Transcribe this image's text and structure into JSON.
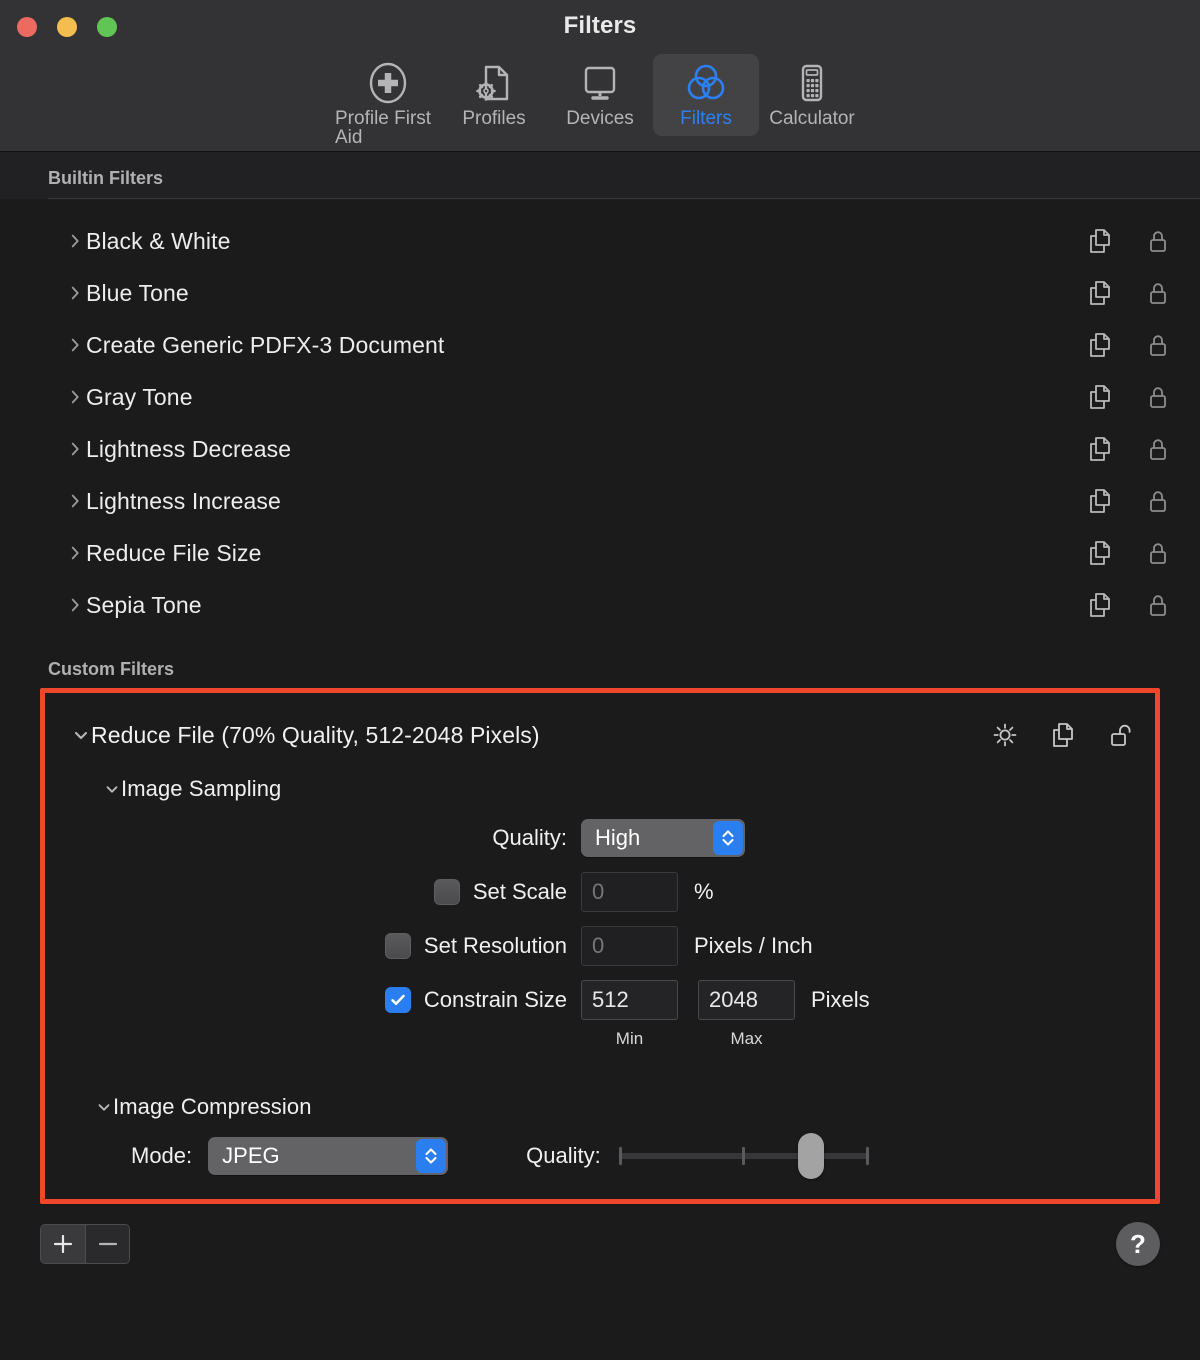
{
  "window": {
    "title": "Filters",
    "traffic_lights": [
      {
        "name": "close",
        "color": "#ec6a5f"
      },
      {
        "name": "minimize",
        "color": "#f4bd4f"
      },
      {
        "name": "zoom",
        "color": "#61c555"
      }
    ]
  },
  "toolbar": {
    "items": [
      {
        "label": "Profile First Aid",
        "icon": "first-aid-icon",
        "selected": false
      },
      {
        "label": "Profiles",
        "icon": "profiles-document-gear-icon",
        "selected": false
      },
      {
        "label": "Devices",
        "icon": "display-monitor-icon",
        "selected": false
      },
      {
        "label": "Filters",
        "icon": "venn-circles-icon",
        "selected": true
      },
      {
        "label": "Calculator",
        "icon": "calculator-icon",
        "selected": false
      }
    ],
    "accent_color": "#2b80f5"
  },
  "builtin_section": {
    "header": "Builtin Filters",
    "filters": [
      {
        "name": "Black & White",
        "expanded": false,
        "locked": true
      },
      {
        "name": "Blue Tone",
        "expanded": false,
        "locked": true
      },
      {
        "name": "Create Generic PDFX-3 Document",
        "expanded": false,
        "locked": true
      },
      {
        "name": "Gray Tone",
        "expanded": false,
        "locked": true
      },
      {
        "name": "Lightness Decrease",
        "expanded": false,
        "locked": true
      },
      {
        "name": "Lightness Increase",
        "expanded": false,
        "locked": true
      },
      {
        "name": "Reduce File Size",
        "expanded": false,
        "locked": true
      },
      {
        "name": "Sepia Tone",
        "expanded": false,
        "locked": true
      }
    ]
  },
  "custom_section": {
    "header": "Custom Filters",
    "highlight_color": "#f0462b",
    "filter": {
      "title": "Reduce File (70% Quality, 512-2048 Pixels)",
      "expanded": true,
      "locked": false,
      "image_sampling": {
        "title": "Image Sampling",
        "expanded": true,
        "quality": {
          "label": "Quality:",
          "value": "High"
        },
        "set_scale": {
          "label": "Set Scale",
          "checked": false,
          "value": "0",
          "unit": "%"
        },
        "set_resolution": {
          "label": "Set Resolution",
          "checked": false,
          "value": "0",
          "unit": "Pixels / Inch"
        },
        "constrain_size": {
          "label": "Constrain Size",
          "checked": true,
          "min_value": "512",
          "max_value": "2048",
          "unit": "Pixels",
          "min_caption": "Min",
          "max_caption": "Max"
        }
      },
      "image_compression": {
        "title": "Image Compression",
        "expanded": true,
        "mode": {
          "label": "Mode:",
          "value": "JPEG"
        },
        "quality_slider": {
          "label": "Quality:",
          "value_percent": 77,
          "min": 0,
          "max": 100,
          "tick_percents": [
            0,
            50,
            100
          ]
        }
      }
    }
  },
  "bottom_bar": {
    "add_label": "+",
    "remove_label": "−",
    "help_label": "?"
  }
}
